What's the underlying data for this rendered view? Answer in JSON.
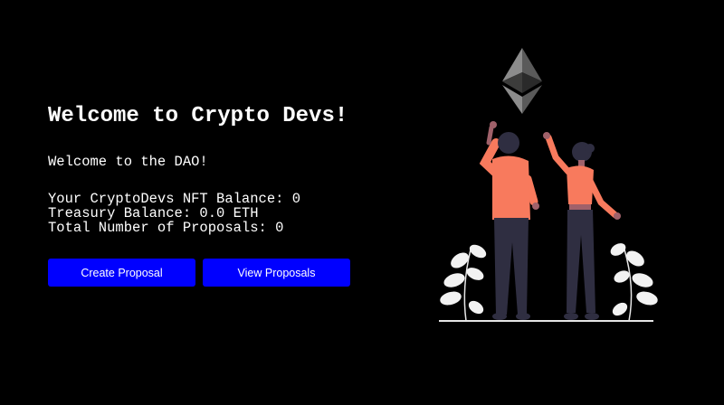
{
  "header": {
    "title": "Welcome to Crypto Devs!"
  },
  "main": {
    "description": "Welcome to the DAO!",
    "stats": {
      "nft_balance": "Your CryptoDevs NFT Balance: 0",
      "treasury_balance": "Treasury Balance: 0.0 ETH",
      "total_proposals": "Total Number of Proposals: 0"
    },
    "buttons": {
      "create_label": "Create Proposal",
      "view_label": "View Proposals"
    }
  },
  "illustration": {
    "icon": "ethereum-icon"
  },
  "colors": {
    "background": "#000000",
    "button": "#0000ff",
    "text": "#ffffff",
    "shirt": "#f87a5d",
    "pants": "#2f2e41",
    "skin": "#a0616a",
    "hair": "#2f2e41"
  }
}
